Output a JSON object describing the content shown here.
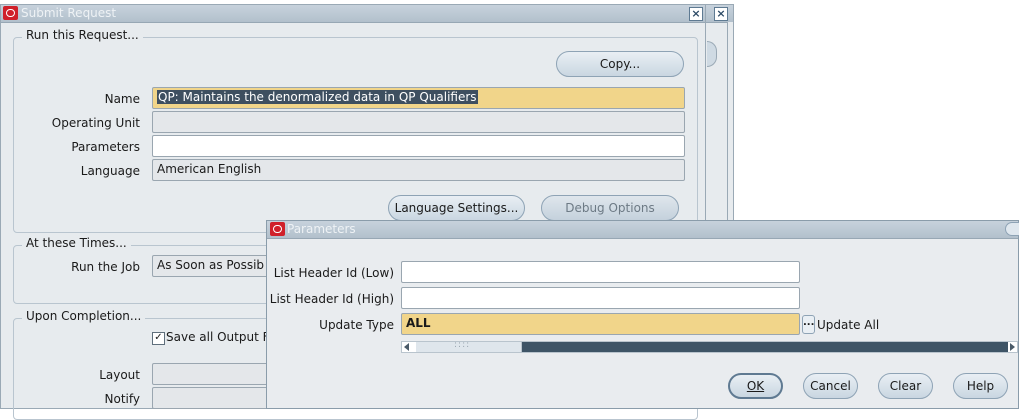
{
  "submit_window": {
    "title": "Submit Request",
    "run_group": {
      "legend": "Run this Request...",
      "copy_button": "Copy...",
      "name_label": "Name",
      "name_value": "QP: Maintains the denormalized data in QP Qualifiers",
      "operating_unit_label": "Operating Unit",
      "operating_unit_value": "",
      "parameters_label": "Parameters",
      "parameters_value": "",
      "language_label": "Language",
      "language_value": "American English",
      "language_settings_button": "Language Settings...",
      "debug_options_button": "Debug Options"
    },
    "times_group": {
      "legend": "At these Times...",
      "run_job_label": "Run the Job",
      "run_job_value": "As Soon as Possib"
    },
    "completion_group": {
      "legend": "Upon Completion...",
      "save_output_label": "Save all Output F",
      "save_output_checked": "✓",
      "layout_label": "Layout",
      "notify_label": "Notify"
    }
  },
  "parameters_dialog": {
    "title": "Parameters",
    "list_header_low_label": "List Header Id (Low)",
    "list_header_low_value": "",
    "list_header_high_label": "List Header Id (High)",
    "list_header_high_value": "",
    "update_type_label": "Update Type",
    "update_type_value": "ALL",
    "update_type_description": "Update All",
    "lov_button": "...",
    "scroll_grip": "::::",
    "ok_button": "OK",
    "cancel_button": "Cancel",
    "clear_button": "Clear",
    "help_button": "Help"
  },
  "colors": {
    "title_bar": "#b2c0cc",
    "brand_icon": "#d0202a",
    "field_highlight": "#f1d58a",
    "window_bg": "#e7ebee"
  }
}
